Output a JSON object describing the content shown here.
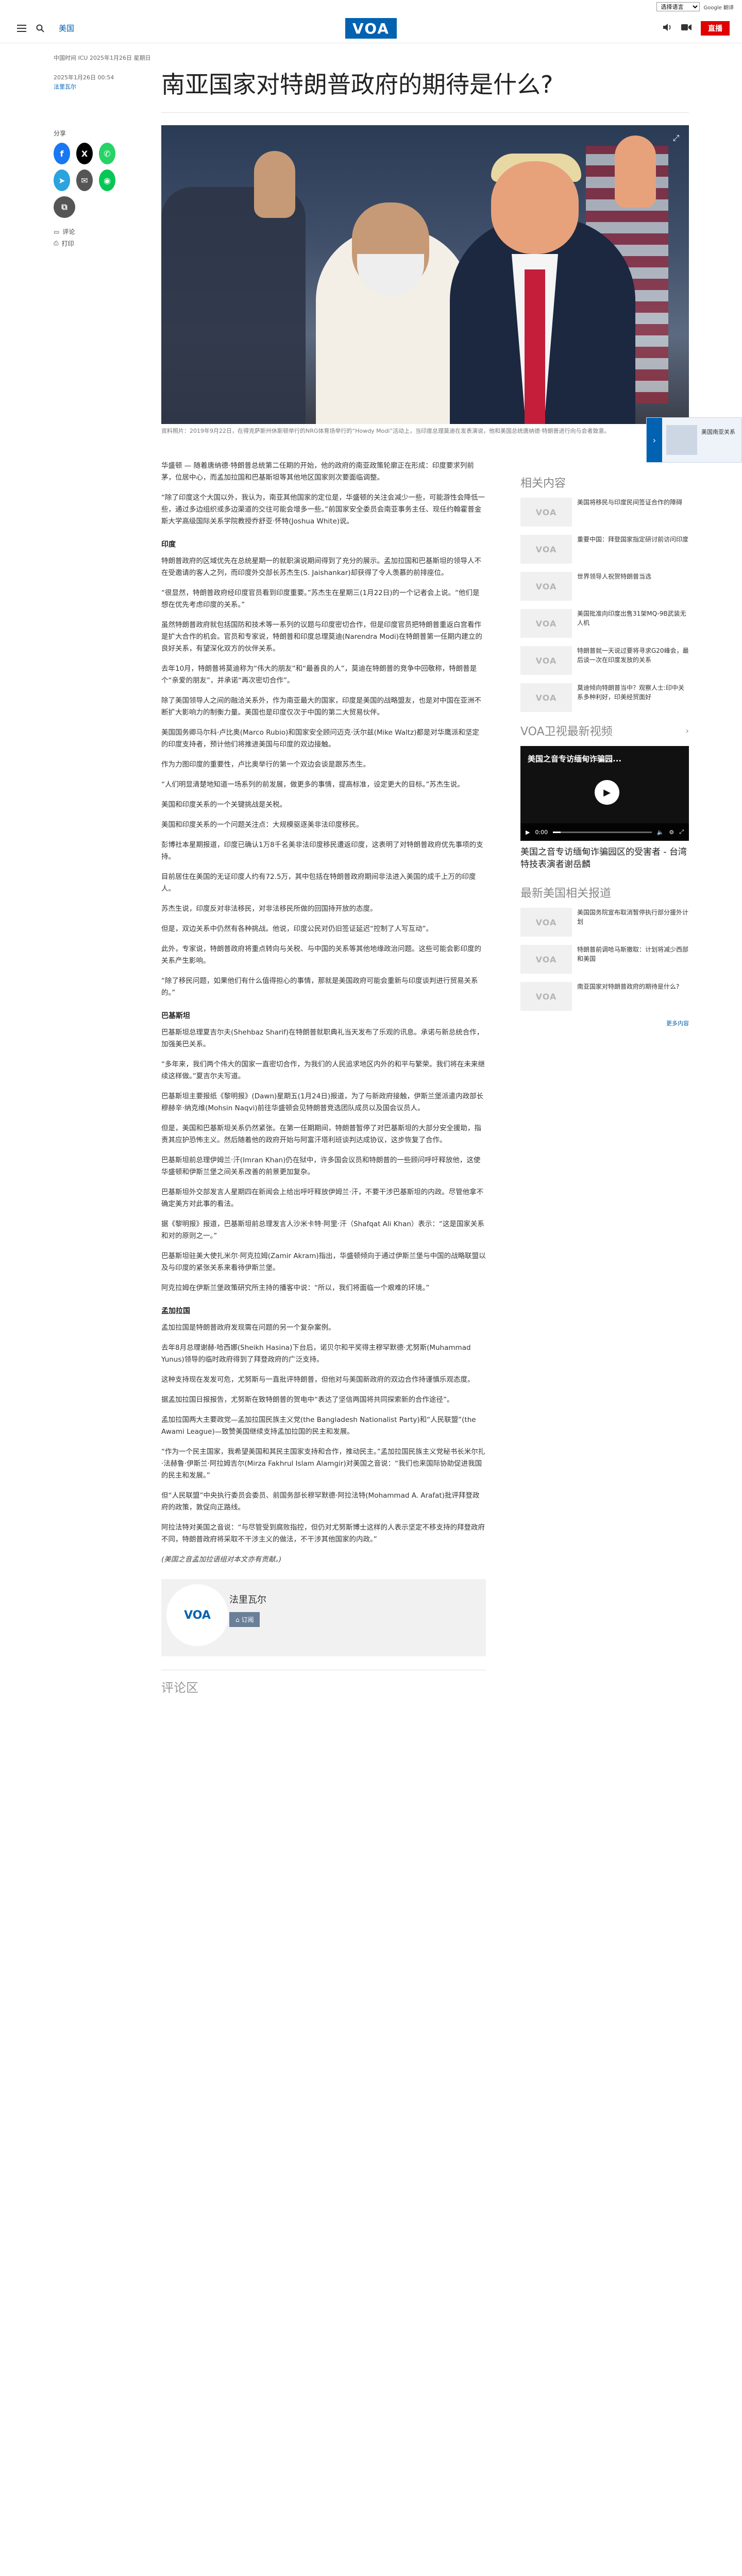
{
  "lang_bar": {
    "select": "选择语言",
    "google": "Google 翻译"
  },
  "header": {
    "section": "美国",
    "logo": "VOA",
    "live": "直播"
  },
  "article": {
    "meta": "中国时间 ICU 2025年1月26日 星期日",
    "date": "2025年1月26日 00:54",
    "author": "法里瓦尔",
    "title": "南亚国家对特朗普政府的期待是什么?",
    "share_label": "分享",
    "comment_link": "评论",
    "print_link": "打印",
    "caption": "资料照片：2019年9月22日，在得克萨斯州休斯顿举行的NRG体育场举行的“Howdy Modi”活动上，当印度总理莫迪在发表演说，他和美国总统唐纳德·特朗普进行向与会者致意。",
    "paragraphs": [
      "华盛顿 — 随着唐纳德·特朗普总统第二任期的开始，他的政府的南亚政策轮廓正在形成：印度要求列前茅，位居中心，而孟加拉国和巴基斯坦等其他地区国家则次要面临调整。",
      "“除了印度这个大国以外，我认为，南亚其他国家的定位是，华盛顿的关注会减少一些，可能游性会降低一些，通过多边组织或多边渠道的交往可能会增多一些。”前国家安全委员会南亚事务主任、现任约翰霍普金斯大学高级国际关系学院教授乔舒亚·怀特(Joshua White)说。"
    ],
    "h_india": "印度",
    "india_paragraphs": [
      "特朗普政府的区域优先在总统星期一的就职演说期间得到了充分的展示。孟加拉国和巴基斯坦的领导人不在受邀请的客人之列，而印度外交部长苏杰生(S. Jaishankar)却获得了令人羡慕的前排座位。",
      "“很显然，特朗普政府经印度官员看到印度重要。”苏杰生在星期三(1月22日)的一个记者会上说。“他们是想在优先考虑印度的关系。”",
      "虽然特朗普政府就包括国防和技术等一系列的议题与印度密切合作，但是印度官员把特朗普重返白宫看作是扩大合作的机会。官员和专家说，特朗普和印度总理莫迪(Narendra Modi)在特朗普第一任期内建立的良好关系，有望深化双方的伙伴关系。",
      "去年10月，特朗普将莫迪称为“伟大的朋友”和“最善良的人”，莫迪在特朗普的竞争中回敬称，特朗普是个“亲爱的朋友”，并承诺“再次密切合作”。",
      "除了美国领导人之间的融洽关系外，作为南亚最大的国家，印度是美国的战略盟友，也是对中国在亚洲不断扩大影响力的制衡力量。美国也是印度仅次于中国的第二大贸易伙伴。",
      "美国国务卿马尔科·卢比奥(Marco Rubio)和国家安全顾问迈克·沃尔兹(Mike Waltz)都是对华鹰派和坚定的印度支持者，预计他们将推进美国与印度的双边接触。",
      "作为力图印度的重要性，卢比奥举行的第一个双边会谈是跟苏杰生。",
      "“人们明显清楚地知道一场系列的前发展，做更多的事情，提高标准，设定更大的目标。”苏杰生说。",
      "美国和印度关系的一个关键挑战是关税。",
      "美国和印度关系的一个问题关注点：大规模驱逐美非法印度移民。",
      "彭博社本星期报道，印度已确认1万8千名美非法印度移民遭返印度，这表明了对特朗普政府优先事项的支持。",
      "目前居住在美国的无证印度人约有72.5万，其中包括在特朗普政府期间非法进入美国的成千上万的印度人。",
      "苏杰生说，印度反对非法移民，对非法移民所做的回国持开放的态度。",
      "但是，双边关系中仍然有各种挑战。他说，印度公民对仍旧签证延迟“控制了人写互动”。",
      "此外，专家说，特朗普政府将重点转向与关税、与中国的关系等其他地缘政治问题。这些可能会影印度的关系产生影响。",
      "“除了移民问题，如果他们有什么值得担心的事情，那就是美国政府可能会重新与印度谈判进行贸易关系的。”"
    ],
    "h_pakistan": "巴基斯坦",
    "pakistan_paragraphs": [
      "巴基斯坦总理夏吉尔夫(Shehbaz Sharif)在特朗普就职典礼当天发布了乐观的讯息。承诺与新总统合作，加强美巴关系。",
      "“多年来，我们两个伟大的国家一直密切合作，为我们的人民追求地区内外的和平与繁荣。我们将在未来继续这样做。”夏吉尔夫写道。",
      "巴基斯坦主要报纸《黎明报》(Dawn)星期五(1月24日)报道，为了与新政府接触，伊斯兰堡派遣内政部长穆赫辛·纳克维(Mohsin Naqvi)前往华盛顿会见特朗普竞选团队成员以及国会议员人。",
      "但是，美国和巴基斯坦关系仍然紧张。在第一任期期间，特朗普暂停了对巴基斯坦的大部分安全援助，指责其应护恐怖主义。然后随着他的政府开始与阿富汗塔利班谈判达成协议，这步恢复了合作。",
      "巴基斯坦前总理伊姆兰·汗(Imran Khan)仍在狱中，许多国会议员和特朗普的一些顾问呼吁释放他，这使华盛顿和伊斯兰堡之间关系改善的前景更加复杂。",
      "巴基斯坦外交部发言人星期四在新闻会上给出呼吁释放伊姆兰·汗，不要干涉巴基斯坦的内政。尽管他拿不确定美方对此事的看法。",
      "据《黎明报》报道，巴基斯坦前总理发言人沙米卡特·阿里·汗（Shafqat Ali Khan）表示：“这是国家关系和对的原则之一。”",
      "巴基斯坦驻美大使扎米尔·阿克拉姆(Zamir Akram)指出，华盛顿倾向于通过伊斯兰堡与中国的战略联盟以及与印度的紧张关系来看待伊斯兰堡。",
      "阿克拉姆在伊斯兰堡政策研究所主持的播客中说：“所以，我们将面临一个艰难的环境。”"
    ],
    "h_bangladesh": "孟加拉国",
    "bangladesh_paragraphs": [
      "孟加拉国是特朗普政府发现需在问题的另一个复杂案例。",
      "去年8月总理谢赫·哈西娜(Sheikh Hasina)下台后，诺贝尔和平奖得主穆罕默德·尤努斯(Muhammad Yunus)领导的临时政府得到了拜登政府的广泛支持。",
      "这种支持现在发发可危，尤努斯与一直批评特朗普，但他对与美国新政府的双边合作持谨慎乐观态度。",
      "据孟加拉国日报报告，尤努斯在致特朗普的贺电中“表达了坚信两国将共同探索新的合作途径”。",
      "孟加拉国两大主要政党—孟加拉国民族主义党(the Bangladesh Nationalist Party)和“人民联盟”(the Awami League)—致赞美国继续支持孟加拉国的民主和发展。",
      "“作为一个民主国家，我希望美国和其民主国家支持和合作，推动民主。”孟加拉国民族主义党秘书长米尔扎·法赫鲁·伊斯兰·阿拉姆吉尔(Mirza Fakhrul Islam Alamgir)对美国之音说：“我们也来国际协助促进我国的民主和发展。”",
      "但“人民联盟”中央执行委员会委员、前国务部长穆罕默德·阿拉法特(Mohammad A. Arafat)批评拜登政府的政策，敦促向正路线。",
      "阿拉法特对美国之音说：“与尽管受到腐败指控，但仍对尤努斯博士这样的人表示坚定不移支持的拜登政府不同，特朗普政府将采取不干涉主义的做法，不干涉其他国家的内政。”"
    ],
    "note": "(美国之音孟加拉语组对本文亦有贡献。)",
    "author_card": {
      "avatar": "VOA",
      "name": "法里瓦尔",
      "subscribe": "订阅"
    },
    "comments_title": "评论区"
  },
  "sidebar": {
    "related_title": "相关内容",
    "related": [
      "美国将移民与印度民间签证合作的障碍",
      "重要中国：拜登国家指定研讨前访问印度",
      "世界领导人祝贺特朗普当选",
      "美国批准向印度出售31架MQ-9B武装无人机",
      "特朗普就一天说过要将寻求G20峰会，最后谈一次在印度发放的关系",
      "莫迪倾向特朗普当中？观察人士:印中关系多种利好，印美经贸面好"
    ],
    "video_title": "VOA卫视最新视频",
    "video_overlay": "美国之音专访缅甸诈骗园...",
    "video_time": "0:00",
    "video_progress": 0.08,
    "video_caption": "美国之音专访缅甸诈骗园区的受害者 - 台湾特技表演者谢岳麟",
    "latest_title": "最新美国相关报道",
    "latest": [
      "美国国务院宣布取消暂停执行部分援外计划",
      "特朗普前调哈马斯撤取：计划将减少西部和美国",
      "南亚国家对特朗普政府的期待是什么?"
    ],
    "more": "更多内容"
  },
  "float_widget": {
    "text": "美国南亚关系"
  },
  "colors": {
    "brand": "#0162b1",
    "live": "#e00000"
  }
}
